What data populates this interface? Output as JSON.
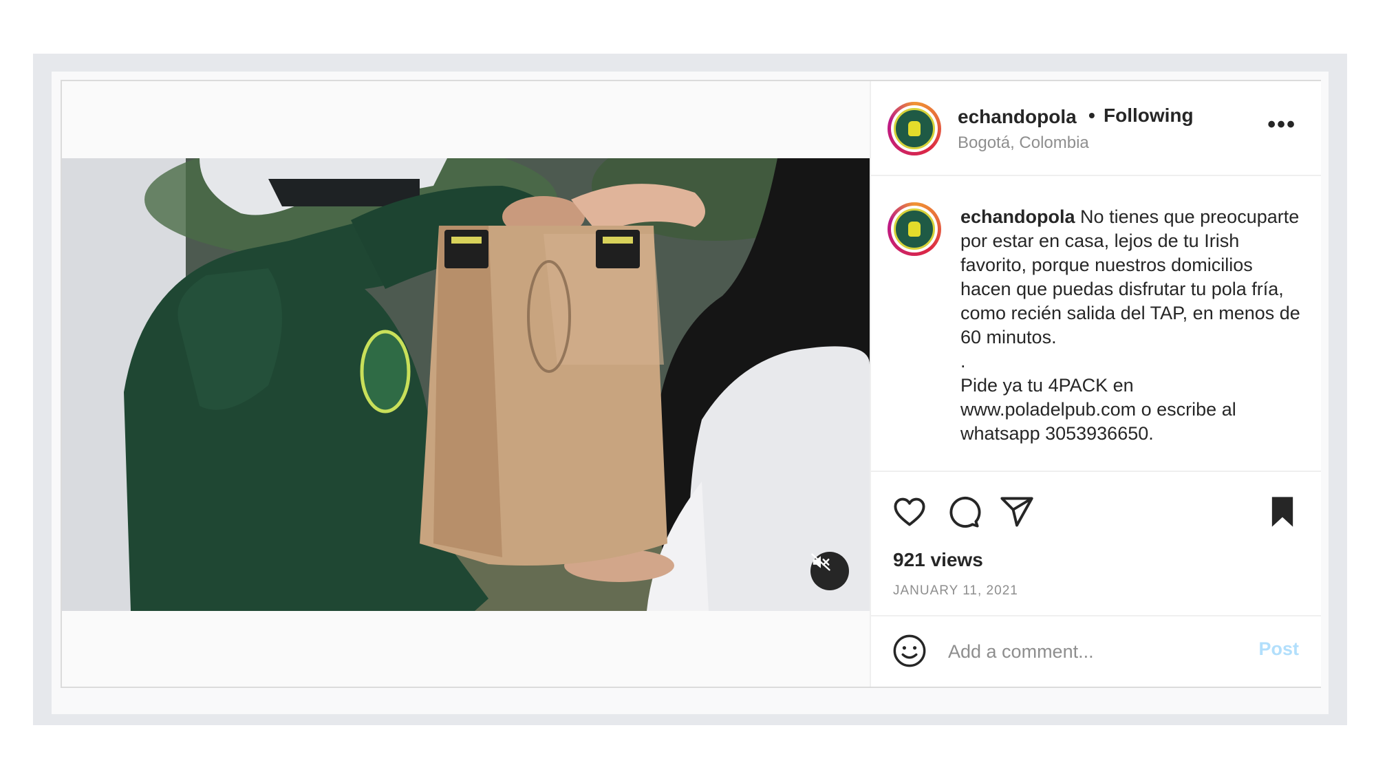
{
  "post": {
    "username": "echandopola",
    "separator": "•",
    "follow_status": "Following",
    "location": "Bogotá, Colombia",
    "more_label": "•••",
    "caption_username": "echandopola",
    "caption_body": "No tienes que preocuparte por estar en casa, lejos de tu Irish favorito, porque nuestros domicilios hacen que puedas disfrutar tu pola fría, como recién salida del TAP, en menos de 60 minutos.\n.\nPide ya tu 4PACK en www.poladelpub.com o escribe al whatsapp 3053936650.",
    "views": "921 views",
    "date": "JANUARY 11, 2021"
  },
  "comment": {
    "placeholder": "Add a comment...",
    "post_label": "Post"
  },
  "icons": {
    "like": "heart-icon",
    "comment": "comment-icon",
    "share": "share-icon",
    "save": "bookmark-icon",
    "emoji": "emoji-icon",
    "mute": "muted-speaker-icon",
    "more": "more-options-icon"
  },
  "colors": {
    "post_button": "#b2dffc",
    "secondary_text": "#8e8e8e",
    "primary_text": "#262626"
  }
}
